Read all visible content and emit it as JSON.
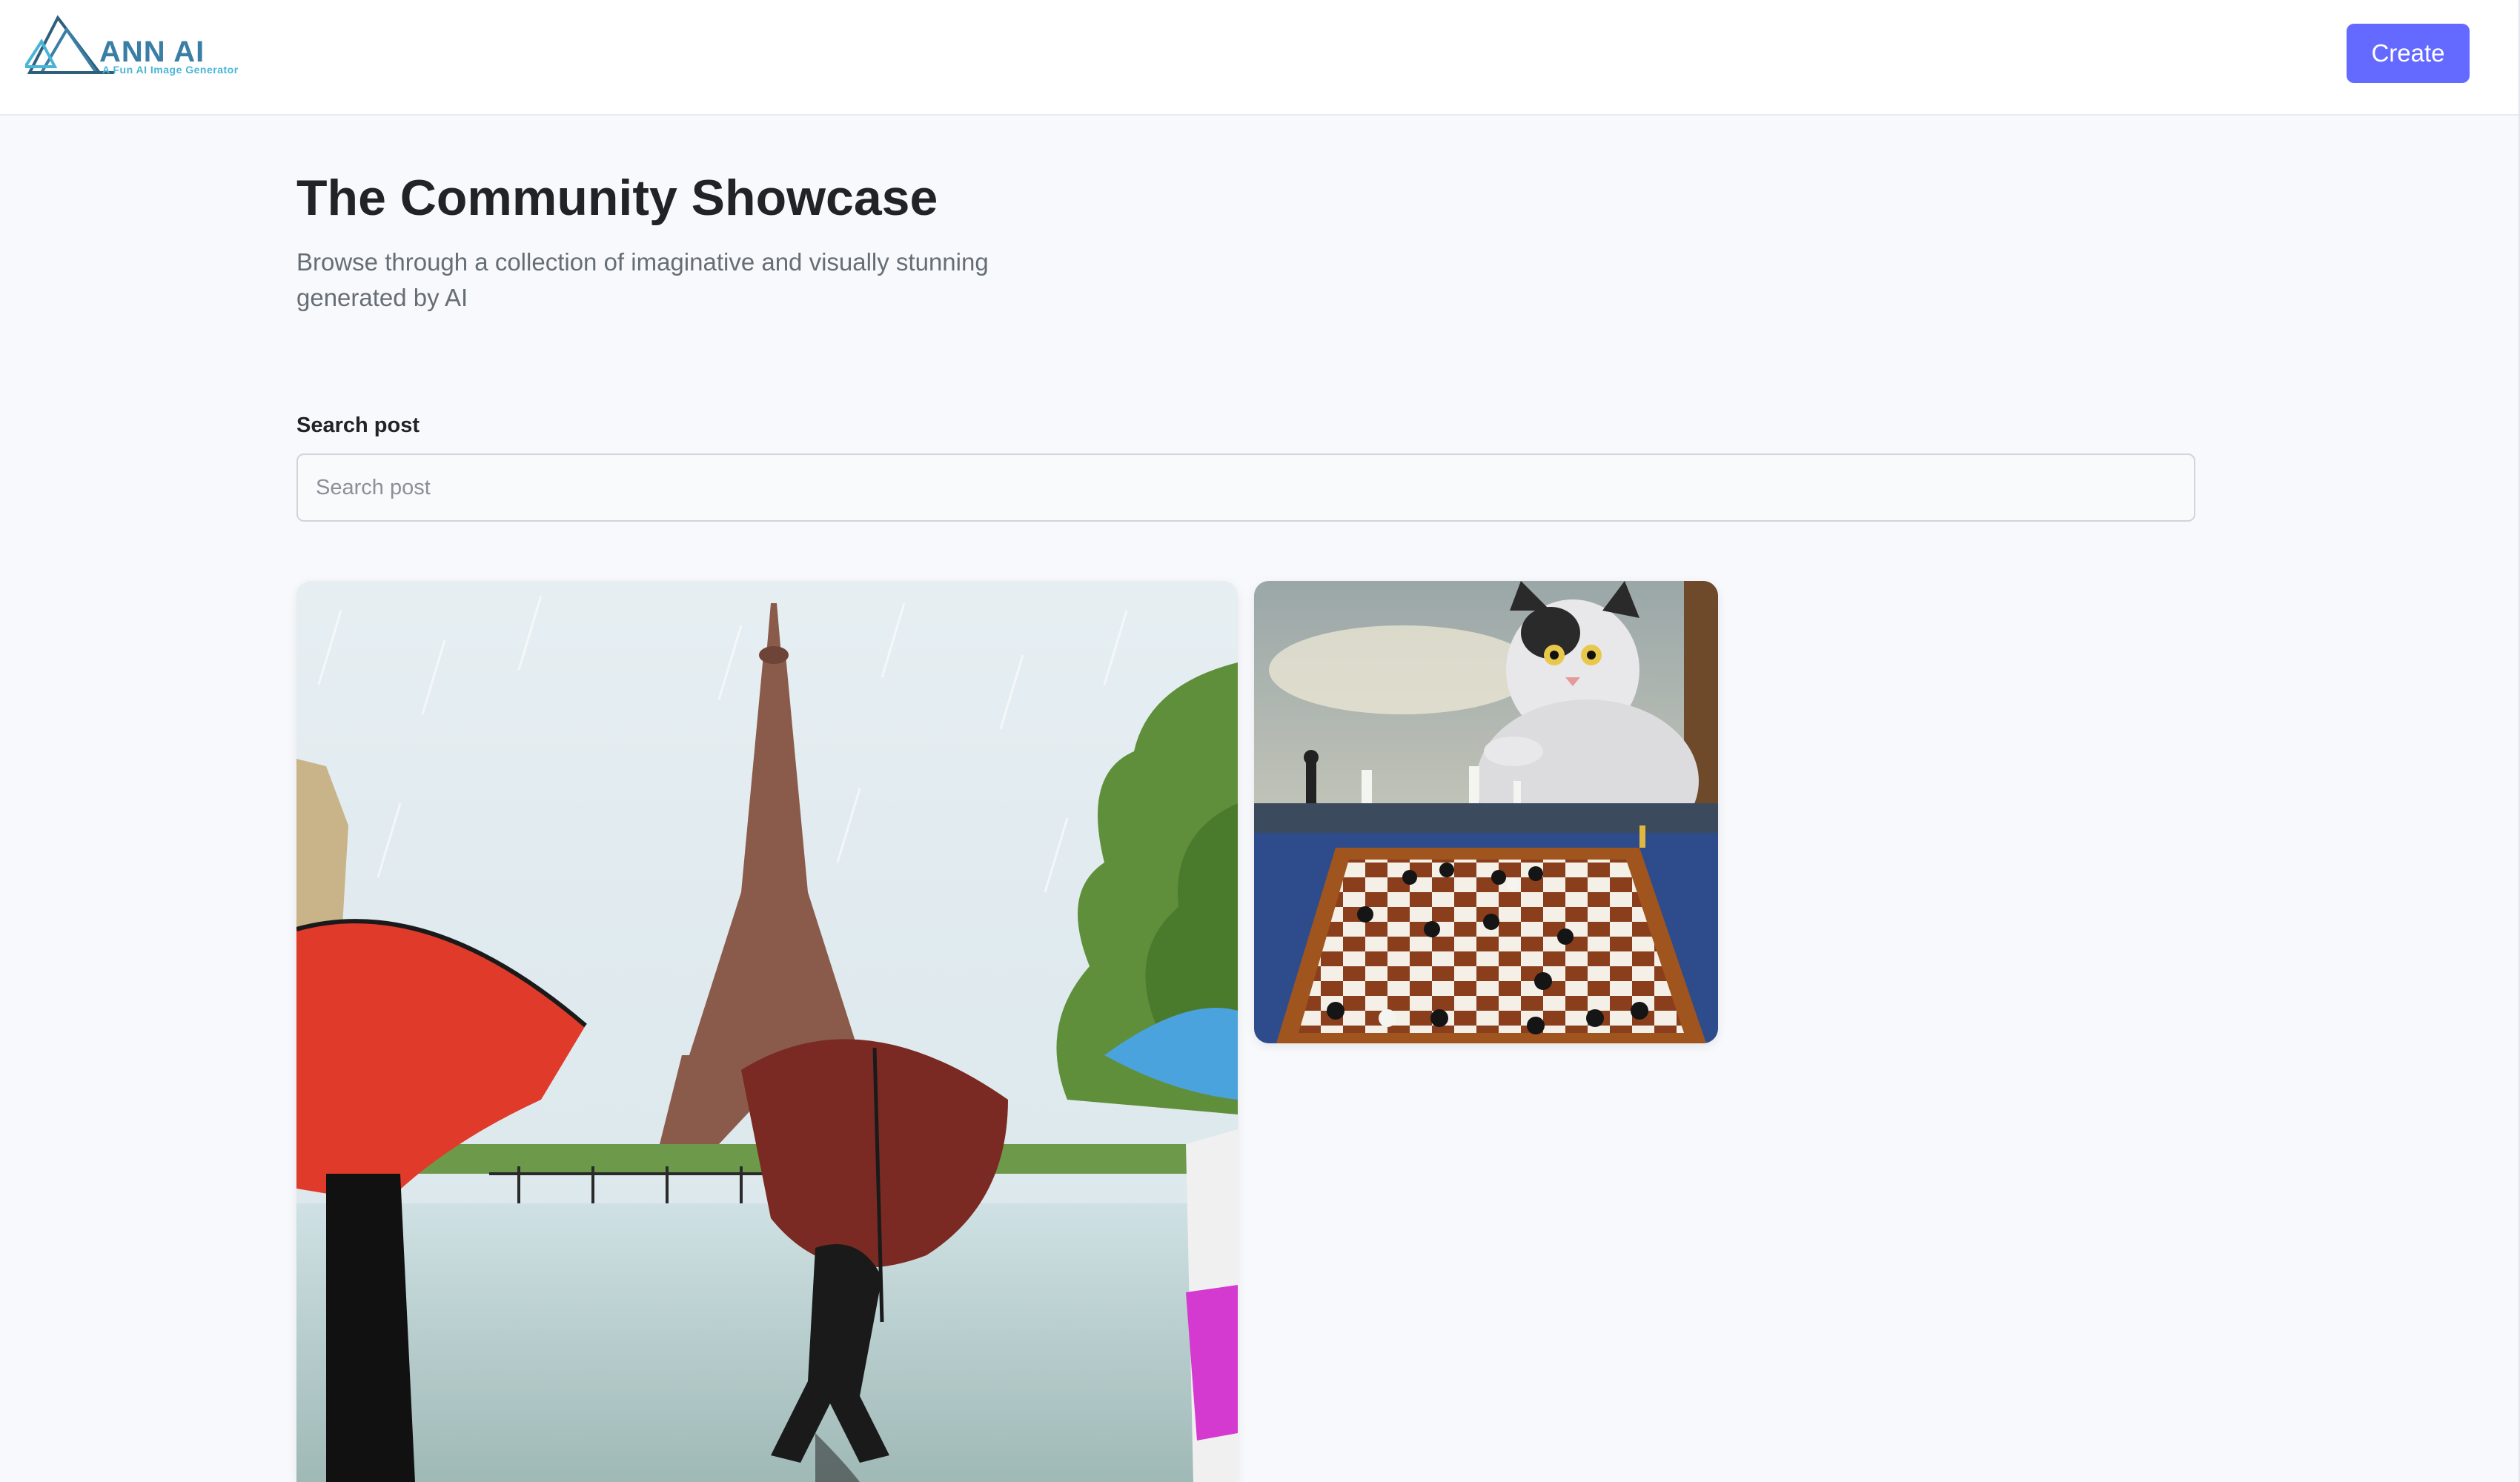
{
  "header": {
    "logo_title": "ANN AI",
    "logo_tagline": "A Fun AI Image Generator",
    "create_label": "Create"
  },
  "main": {
    "title": "The Community Showcase",
    "subtitle": "Browse through a collection of imaginative and visually stunning generated by AI",
    "search": {
      "label": "Search post",
      "placeholder": "Search post",
      "value": ""
    }
  },
  "colors": {
    "accent": "#6469ff",
    "background": "#f8f9fd",
    "logo": "#3a7ea6"
  },
  "icons": [
    "logo-triangle-icon"
  ]
}
